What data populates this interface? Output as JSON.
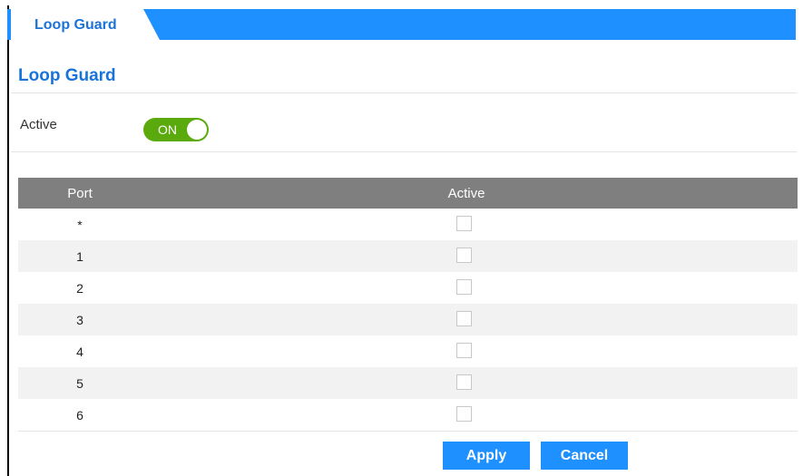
{
  "tab": {
    "label": "Loop Guard"
  },
  "section": {
    "title": "Loop Guard"
  },
  "active": {
    "label": "Active",
    "toggle_text": "ON",
    "state": true
  },
  "table": {
    "headers": [
      "Port",
      "Active"
    ],
    "rows": [
      {
        "port": "*",
        "checked": false
      },
      {
        "port": "1",
        "checked": false
      },
      {
        "port": "2",
        "checked": false
      },
      {
        "port": "3",
        "checked": false
      },
      {
        "port": "4",
        "checked": false
      },
      {
        "port": "5",
        "checked": false
      },
      {
        "port": "6",
        "checked": false
      }
    ]
  },
  "buttons": {
    "apply": "Apply",
    "cancel": "Cancel"
  },
  "colors": {
    "accent": "#1e90ff",
    "title": "#1a73d9",
    "toggle_on": "#5aaa0d",
    "header_bg": "#7f7f7f"
  }
}
